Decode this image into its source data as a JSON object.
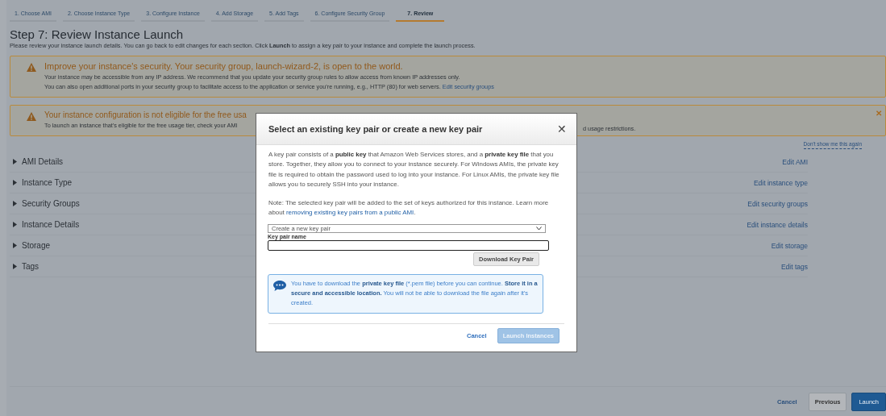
{
  "tabs": [
    {
      "label": "1. Choose AMI",
      "selected": false
    },
    {
      "label": "2. Choose Instance Type",
      "selected": false
    },
    {
      "label": "3. Configure Instance",
      "selected": false
    },
    {
      "label": "4. Add Storage",
      "selected": false
    },
    {
      "label": "5. Add Tags",
      "selected": false
    },
    {
      "label": "6. Configure Security Group",
      "selected": false
    },
    {
      "label": "7. Review",
      "selected": true
    }
  ],
  "title": "Step 7: Review Instance Launch",
  "description": "Please review your instance launch details. You can go back to edit changes for each section. Click **Launch** to assign a key pair to your instance and complete the launch process.",
  "alerts": [
    {
      "title": "Improve your instance's security. Your security group, launch-wizard-2, is open to the world.",
      "lines": [
        {
          "text": "Your instance may be accessible from any IP address. We recommend that you update your security group rules to allow access from known IP addresses only."
        },
        {
          "text": "You can also open additional ports in your security group to facilitate access to the application or service you're running, e.g., HTTP (80) for web servers.",
          "link": "Edit security groups"
        }
      ]
    },
    {
      "title": "Your instance configuration is not eligible for the free usa",
      "lines": [
        {
          "text": "To launch an instance that's eligible for the free usage tier, check your AMI",
          "tail": "d usage restrictions."
        }
      ],
      "close": "✕"
    }
  ],
  "dismiss_link": "Don't show me this again",
  "sections": [
    {
      "label": "AMI Details",
      "expanded": false,
      "edit_link": "Edit AMI"
    },
    {
      "label": "Instance Type",
      "expanded": false,
      "edit_link": "Edit instance type"
    },
    {
      "label": "Security Groups",
      "expanded": false,
      "edit_link": "Edit security groups"
    },
    {
      "label": "Instance Details",
      "expanded": false,
      "edit_link": "Edit instance details"
    },
    {
      "label": "Storage",
      "expanded": false,
      "edit_link": "Edit storage"
    },
    {
      "label": "Tags",
      "expanded": false,
      "edit_link": "Edit tags"
    }
  ],
  "footer": {
    "cancel": "Cancel",
    "previous": "Previous",
    "launch": "Launch"
  },
  "modal": {
    "title": "Select an existing key pair or create a new key pair",
    "close": "✕",
    "intro": "A key pair consists of a **public key** that Amazon Web Services stores, and a **private key file** that you store. Together, they allow you to connect to your instance securely. For Windows AMIs, the private key file is required to obtain the password used to log into your instance. For Linux AMIs, the private key file allows you to securely SSH into your instance.",
    "note": "Note: The selected key pair will be added to the set of keys authorized for this instance. Learn more about",
    "note_link": "removing existing key pairs from a public AMI",
    "note_end": ".",
    "select_value": "Create a new key pair",
    "field_label": "Key pair name",
    "download_button": "Download Key Pair",
    "info": "You have to download the **private key file** (*.pem file) before you can continue. **Store it in a secure and accessible location.** You will not be able to download the file again after it's created.",
    "cancel": "Cancel",
    "launch": {
      "label": "Launch Instances",
      "disabled": true
    }
  }
}
